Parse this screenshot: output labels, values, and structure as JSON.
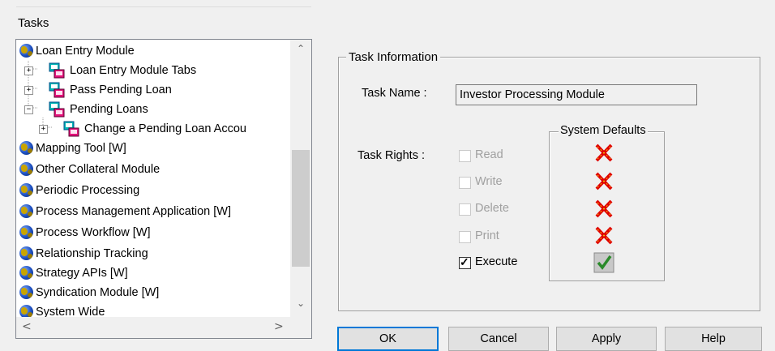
{
  "tasks_label": "Tasks",
  "tree": {
    "items": [
      {
        "label": "Loan Entry Module",
        "level": 0,
        "icon": "globe-icon",
        "expander": ""
      },
      {
        "label": "Loan Entry Module Tabs",
        "level": 1,
        "icon": "module-icon",
        "expander": "+"
      },
      {
        "label": "Pass Pending Loan",
        "level": 1,
        "icon": "module-icon",
        "expander": "+"
      },
      {
        "label": "Pending Loans",
        "level": 1,
        "icon": "module-icon",
        "expander": "−"
      },
      {
        "label": "Change a Pending Loan Accou",
        "level": 2,
        "icon": "module-icon",
        "expander": "+"
      },
      {
        "label": "Mapping Tool [W]",
        "level": 0,
        "icon": "globe-icon",
        "expander": ""
      },
      {
        "label": "Other Collateral Module",
        "level": 0,
        "icon": "globe-icon",
        "expander": ""
      },
      {
        "label": "Periodic Processing",
        "level": 0,
        "icon": "globe-icon",
        "expander": ""
      },
      {
        "label": "Process Management Application [W]",
        "level": 0,
        "icon": "globe-icon",
        "expander": ""
      },
      {
        "label": "Process Workflow [W]",
        "level": 0,
        "icon": "globe-icon",
        "expander": ""
      },
      {
        "label": "Relationship Tracking",
        "level": 0,
        "icon": "globe-icon",
        "expander": ""
      },
      {
        "label": "Strategy APIs [W]",
        "level": 0,
        "icon": "globe-icon",
        "expander": ""
      },
      {
        "label": "Syndication Module [W]",
        "level": 0,
        "icon": "globe-icon",
        "expander": ""
      },
      {
        "label": "System Wide",
        "level": 0,
        "icon": "globe-icon",
        "expander": ""
      }
    ]
  },
  "task_info": {
    "group_label": "Task Information",
    "task_name_label": "Task Name :",
    "task_name_value": "Investor Processing Module",
    "task_rights_label": "Task Rights :",
    "rights": [
      {
        "label": "Read",
        "checked": false,
        "enabled": false
      },
      {
        "label": "Write",
        "checked": false,
        "enabled": false
      },
      {
        "label": "Delete",
        "checked": false,
        "enabled": false
      },
      {
        "label": "Print",
        "checked": false,
        "enabled": false
      },
      {
        "label": "Execute",
        "checked": true,
        "enabled": true
      }
    ],
    "system_defaults_label": "System Defaults",
    "system_defaults": [
      "red-x-icon",
      "red-x-icon",
      "red-x-icon",
      "red-x-icon",
      "green-check-icon"
    ]
  },
  "buttons": {
    "ok": "OK",
    "cancel": "Cancel",
    "apply": "Apply",
    "help": "Help"
  },
  "colors": {
    "window_bg": "#f0f0f0",
    "focus_border": "#0078d7",
    "x_red": "#e00000",
    "check_green": "#2a8a2a"
  }
}
